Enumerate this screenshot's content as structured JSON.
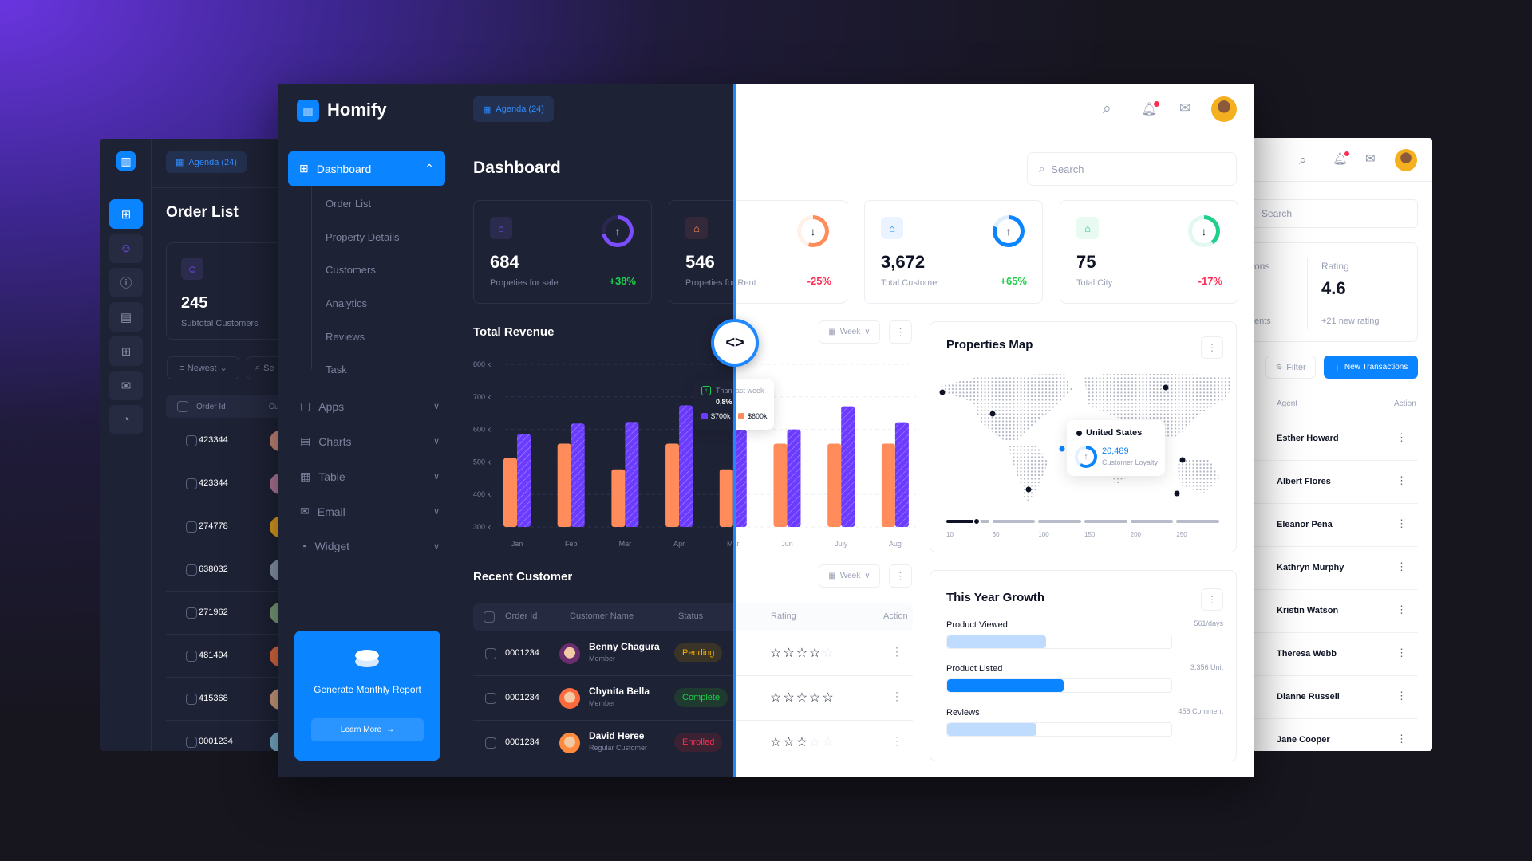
{
  "back_left": {
    "agenda_label": "Agenda (24)",
    "title": "Order List",
    "stat": {
      "value": "245",
      "label": "Subtotal Customers"
    },
    "sort_label": "Newest",
    "search_placeholder": "Se",
    "table_headers": [
      "Order Id",
      "Cust"
    ],
    "rows": [
      "423344",
      "423344",
      "274778",
      "638032",
      "271962",
      "481494",
      "415368",
      "0001234"
    ],
    "rail_icons": [
      "grid-icon",
      "users-icon",
      "info-icon",
      "chart-icon",
      "apps-icon",
      "mail-icon",
      "pie-icon"
    ]
  },
  "back_right": {
    "search_placeholder": "Search",
    "stat_left": {
      "label": "ons",
      "sub": "ents"
    },
    "stat_rating": {
      "label": "Rating",
      "value": "4.6",
      "sub": "+21 new rating"
    },
    "filter_label": "Filter",
    "new_label": "New Transactions",
    "table_headers": {
      "agent": "Agent",
      "action": "Action"
    },
    "agents": [
      "Esther Howard",
      "Albert Flores",
      "Eleanor Pena",
      "Kathryn Murphy",
      "Kristin Watson",
      "Theresa Webb",
      "Dianne Russell",
      "Jane Cooper"
    ]
  },
  "app": {
    "name": "Homify",
    "agenda_label": "Agenda (24)"
  },
  "sidebar": {
    "active": "Dashboard",
    "sub_items": [
      "Order List",
      "Property Details",
      "Customers",
      "Analytics",
      "Reviews",
      "Task"
    ],
    "groups": [
      {
        "label": "Apps",
        "icon": "apps-icon"
      },
      {
        "label": "Charts",
        "icon": "chart-icon"
      },
      {
        "label": "Table",
        "icon": "table-icon"
      },
      {
        "label": "Email",
        "icon": "mail-icon"
      },
      {
        "label": "Widget",
        "icon": "pie-icon"
      }
    ],
    "promo": {
      "title": "Generate Monthly Report",
      "button": "Learn More"
    }
  },
  "page": {
    "title": "Dashboard",
    "search_placeholder": "Search"
  },
  "stats": [
    {
      "value": "684",
      "label": "Propeties for sale",
      "change": "+38%",
      "direction": "up",
      "ring": 0.72,
      "color": "#7c4dff",
      "icon_bg": "#2a2b4d"
    },
    {
      "value": "546",
      "label": "Propeties for Rent",
      "change": "-25%",
      "direction": "down",
      "ring": 0.55,
      "color": "#ff8c5a",
      "icon_bg": "#33293a"
    },
    {
      "value": "3,672",
      "label": "Total Customer",
      "change": "+65%",
      "direction": "up",
      "ring": 0.8,
      "color": "#0a84ff",
      "icon_bg": "#eaf3ff"
    },
    {
      "value": "75",
      "label": "Total City",
      "change": "-17%",
      "direction": "down",
      "ring": 0.4,
      "color": "#1fcf8c",
      "icon_bg": "#e8faf2"
    }
  ],
  "revenue": {
    "title": "Total Revenue",
    "period": "Week",
    "tooltip": {
      "label": "Than last week",
      "change": "0,8%",
      "series_a": "$700k",
      "series_b": "$600k"
    }
  },
  "chart_data": {
    "type": "bar",
    "title": "Total Revenue",
    "categories": [
      "Jan",
      "Feb",
      "Mar",
      "Apr",
      "Mar",
      "Jun",
      "July",
      "Aug"
    ],
    "series": [
      {
        "values": [
          512,
          556,
          477,
          556,
          477,
          556,
          556,
          556
        ],
        "color": "#ff8c5a"
      },
      {
        "values": [
          586,
          618,
          623,
          674,
          600,
          600,
          671,
          622
        ],
        "color": "#6b3cff"
      }
    ],
    "y_ticks": [
      "800 k",
      "700 k",
      "600 k",
      "500 k",
      "400 k",
      "300 k"
    ],
    "ylim": [
      300,
      800
    ],
    "grid": true
  },
  "map": {
    "title": "Properties Map",
    "tooltip": {
      "country": "United States",
      "value": "20,489",
      "label": "Customer Loyalty"
    },
    "scale_labels": [
      "10",
      "60",
      "100",
      "150",
      "200",
      "250"
    ],
    "slider_value": 43
  },
  "growth": {
    "title": "This Year Growth",
    "items": [
      {
        "label": "Product Viewed",
        "value": "561/days",
        "fraction": 0.44,
        "color": "#bfdcff"
      },
      {
        "label": "Product Listed",
        "value": "3,356 Unit",
        "fraction": 0.52,
        "color": "#0a84ff"
      },
      {
        "label": "Reviews",
        "value": "456 Comment",
        "fraction": 0.4,
        "color": "#bfdcff"
      }
    ]
  },
  "customers": {
    "title": "Recent Customer",
    "period": "Week",
    "headers": [
      "Order Id",
      "Customer Name",
      "Status",
      "Rating",
      "Action"
    ],
    "rows": [
      {
        "id": "0001234",
        "name": "Benny Chagura",
        "role": "Member",
        "status": "Pending",
        "rating": 4,
        "status_color": "#f5b301",
        "status_bg": "#3a3428",
        "avatar": "#6a2d6e"
      },
      {
        "id": "0001234",
        "name": "Chynita Bella",
        "role": "Member",
        "status": "Complete",
        "rating": 5,
        "status_color": "#1fcf4c",
        "status_bg": "#1f3a2e",
        "avatar": "#ff6a3d"
      },
      {
        "id": "0001234",
        "name": "David Heree",
        "role": "Regular Customer",
        "status": "Enrolled",
        "rating": 3,
        "status_color": "#ff2d55",
        "status_bg": "#3a2233",
        "avatar": "#ff8a3d"
      }
    ]
  }
}
